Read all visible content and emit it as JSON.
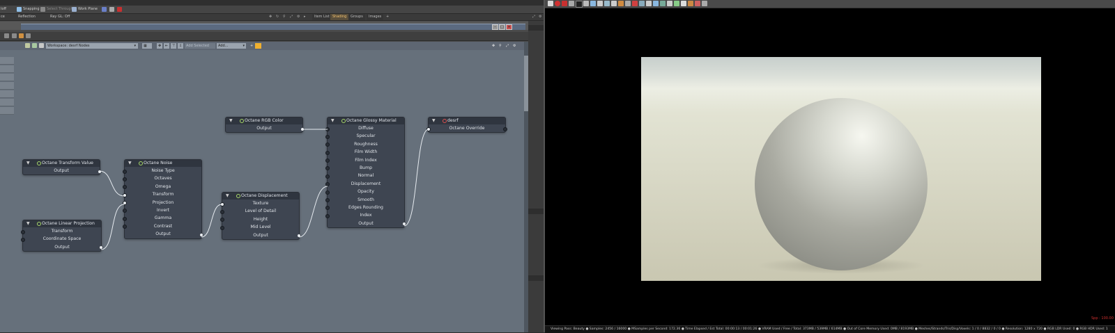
{
  "toolbar": {
    "left_cut": "Ioff",
    "snapping": "Snapping",
    "select_through": "Select Through",
    "work_plane": "Work Plane"
  },
  "subbar": {
    "left_cut": "ce",
    "reflection": "Reflection",
    "ray_gl": "Ray GL: Off"
  },
  "tabs": [
    {
      "label": "Item List"
    },
    {
      "label": "Shading"
    },
    {
      "label": "Groups"
    },
    {
      "label": "Images"
    },
    {
      "label": "+"
    }
  ],
  "workspace": {
    "workspace_label": "Workspace: desrf Nodes",
    "add_selected": "Add Selected",
    "add_dropdown": "Add..."
  },
  "nodes": {
    "rgb_color": {
      "title": "Octane RGB Color",
      "rows": [
        "Output"
      ]
    },
    "glossy": {
      "title": "Octane Glossy Material",
      "rows": [
        "Diffuse",
        "Specular",
        "Roughness",
        "Film Width",
        "Film Index",
        "Bump",
        "Normal",
        "Displacement",
        "Opacity",
        "Smooth",
        "Edges Rounding",
        "Index",
        "Output"
      ]
    },
    "desrf": {
      "title": "desrf",
      "rows": [
        "Octane Override"
      ]
    },
    "transform_value": {
      "title": "Octane Transform Value",
      "rows": [
        "Output"
      ]
    },
    "noise": {
      "title": "Octane Noise",
      "rows": [
        "Noise Type",
        "Octaves",
        "Omega",
        "Transform",
        "Projection",
        "Invert",
        "Gamma",
        "Contrast",
        "Output"
      ]
    },
    "displacement": {
      "title": "Octane Displacement",
      "rows": [
        "Texture",
        "Level of Detail",
        "Height",
        "Mid Level",
        "Output"
      ]
    },
    "linear_projection": {
      "title": "Octane Linear Projection",
      "rows": [
        "Transform",
        "Coordinate Space",
        "Output"
      ]
    }
  },
  "viewer": {
    "status": "Viewing Pass: Beauty ● Samples: 2456 / 16000 ● MSamples per Second: 172.36 ● Time Elapsed / Est Total: 00:00:13 / 00:01:26 ● VRAM Used / Free / Total: 373MB / 539MB / 614MB ● Out of Core Memory Used: 0MB / 8193MB ● Meshes/Strands/Tris/Disp/Voxels: 1 / 0 / 8832 / 0 / 0 ● Resolution: 1280 x 720 ● RGB LDR Used: 0 ● RGB HDR Used: 1",
    "spp": "Spp : 100.00"
  },
  "colors": {
    "canvas": "#66707b",
    "node_body": "#3e4551",
    "node_header": "#2f353f",
    "wire": "#e6ebf0",
    "active_tab": "#f0c070"
  }
}
